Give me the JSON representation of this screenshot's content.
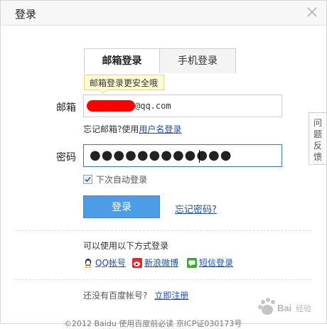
{
  "dialog": {
    "title": "登录"
  },
  "tabs": [
    {
      "label": "邮箱登录",
      "active": true
    },
    {
      "label": "手机登录",
      "active": false
    }
  ],
  "tooltip": "邮箱登录更安全哦",
  "email": {
    "label": "邮箱",
    "value_domain": "@qq.com",
    "value_prefix_redacted": true
  },
  "forgot_email": {
    "text": "忘记邮箱?使用",
    "link": "用户名登录"
  },
  "password": {
    "label": "密码",
    "masked_value": "●●●●●●●●●●●●"
  },
  "remember": {
    "label": "下次自动登录",
    "checked": true
  },
  "buttons": {
    "login": "登录",
    "forgot_password": "忘记密码?"
  },
  "alt_login": {
    "heading": "可以使用以下方式登录",
    "items": [
      {
        "label": "QQ帐号",
        "icon": "qq-icon"
      },
      {
        "label": "新浪微博",
        "icon": "weibo-icon"
      },
      {
        "label": "短信登录",
        "icon": "sms-icon"
      }
    ]
  },
  "register": {
    "text": "还没有百度帐号?",
    "link": "立即注册"
  },
  "footer": "©2012 Baidu 使用百度前必读 京ICP证030173号",
  "feedback": [
    "问",
    "题",
    "反",
    "馈"
  ],
  "colors": {
    "login_button": "#4d9de6",
    "link": "#1a4fba",
    "tooltip_bg": "#fffbd5",
    "redaction": "#ff0000"
  }
}
